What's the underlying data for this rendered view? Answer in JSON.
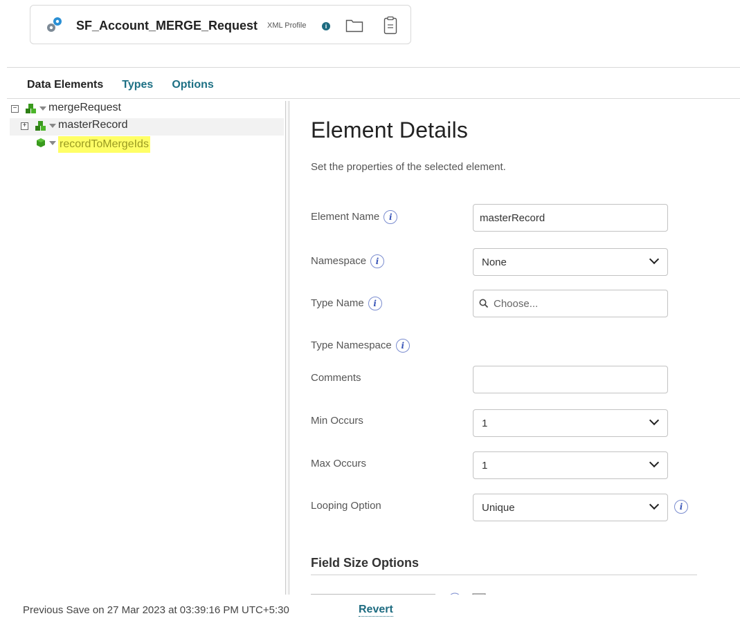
{
  "header": {
    "title": "SF_Account_MERGE_Request",
    "subtype": "XML Profile",
    "component_icon": "gears-icon",
    "info_icon": "info-icon",
    "folder_icon": "folder-icon",
    "clipboard_icon": "clipboard-icon"
  },
  "tabs": [
    {
      "label": "Data Elements",
      "active": true
    },
    {
      "label": "Types",
      "active": false
    },
    {
      "label": "Options",
      "active": false
    }
  ],
  "tree": {
    "nodes": [
      {
        "label": "mergeRequest",
        "toggle": "⊟"
      },
      {
        "label": "masterRecord",
        "toggle": "⊞"
      },
      {
        "label": "recordToMergeIds"
      }
    ]
  },
  "details": {
    "title": "Element Details",
    "description": "Set the properties of the selected element.",
    "fields": {
      "element_name": {
        "label": "Element Name",
        "value": "masterRecord"
      },
      "namespace": {
        "label": "Namespace",
        "value": "None"
      },
      "type_name": {
        "label": "Type Name",
        "placeholder": "Choose..."
      },
      "type_namespace": {
        "label": "Type Namespace"
      },
      "comments": {
        "label": "Comments",
        "value": ""
      },
      "min_occurs": {
        "label": "Min Occurs",
        "value": "1"
      },
      "max_occurs": {
        "label": "Max Occurs",
        "value": "1"
      },
      "looping_option": {
        "label": "Looping Option",
        "value": "Unique"
      }
    },
    "section_title": "Field Size Options"
  },
  "footer": {
    "save_text": "Previous Save on 27 Mar 2023 at 03:39:16 PM UTC+5:30",
    "revert_label": "Revert"
  },
  "colors": {
    "accent": "#1d6b80",
    "highlight": "#ffff66",
    "node_green": "#3a9a1e"
  }
}
